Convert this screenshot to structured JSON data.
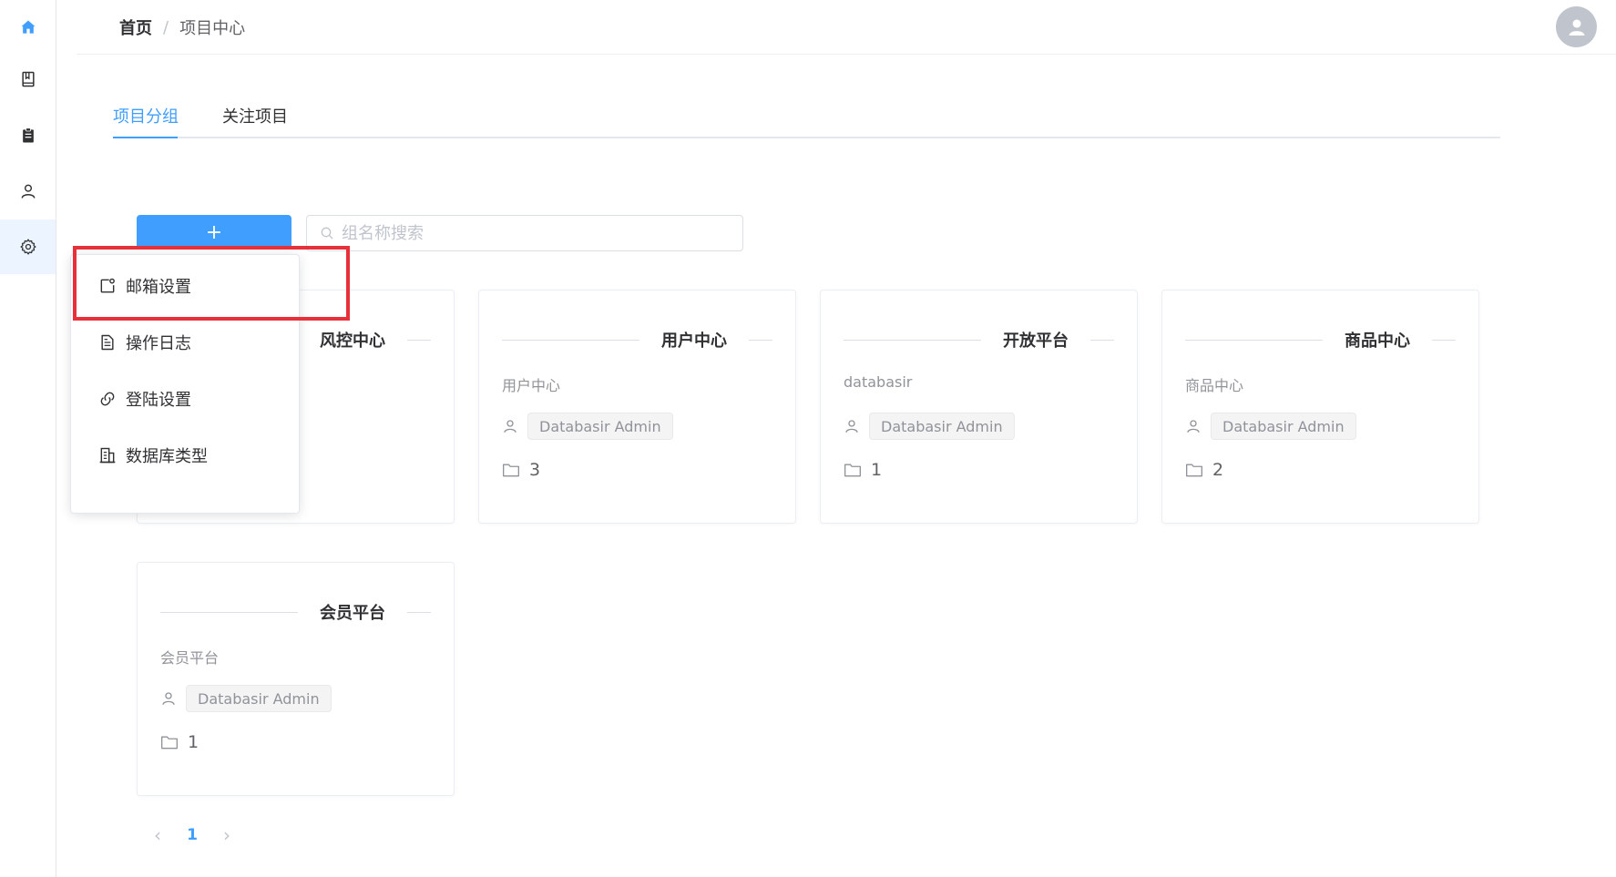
{
  "sidebar": {
    "items": [
      {
        "icon": "home-icon",
        "active": false
      },
      {
        "icon": "book-icon",
        "active": false
      },
      {
        "icon": "clipboard-icon",
        "active": false
      },
      {
        "icon": "user-icon",
        "active": false
      },
      {
        "icon": "gear-icon",
        "active": true
      }
    ]
  },
  "header": {
    "breadcrumb_home": "首页",
    "breadcrumb_sep": "/",
    "breadcrumb_current": "项目中心",
    "avatar_icon": "user-avatar-icon"
  },
  "tabs": [
    {
      "label": "项目分组",
      "active": true
    },
    {
      "label": "关注项目",
      "active": false
    }
  ],
  "toolbar": {
    "add_label": "+",
    "search_placeholder": "组名称搜索"
  },
  "cards": [
    {
      "title": "风控中心"
    },
    {
      "title": "用户中心",
      "description": "用户中心",
      "owner": "Databasir Admin",
      "count": "3"
    },
    {
      "title": "开放平台",
      "description": "databasir",
      "owner": "Databasir Admin",
      "count": "1"
    },
    {
      "title": "商品中心",
      "description": "商品中心",
      "owner": "Databasir Admin",
      "count": "2"
    },
    {
      "title": "会员平台",
      "description": "会员平台",
      "owner": "Databasir Admin",
      "count": "1"
    }
  ],
  "dropdown": {
    "items": [
      {
        "label": "邮箱设置",
        "icon": "mail-settings-icon"
      },
      {
        "label": "操作日志",
        "icon": "document-icon"
      },
      {
        "label": "登陆设置",
        "icon": "link-icon"
      },
      {
        "label": "数据库类型",
        "icon": "database-type-icon"
      }
    ]
  },
  "pagination": {
    "prev": "‹",
    "current": "1",
    "next": "›"
  },
  "colors": {
    "primary": "#409eff",
    "highlight": "#e8303a",
    "sidebar_active_bg": "#ecf5ff"
  }
}
